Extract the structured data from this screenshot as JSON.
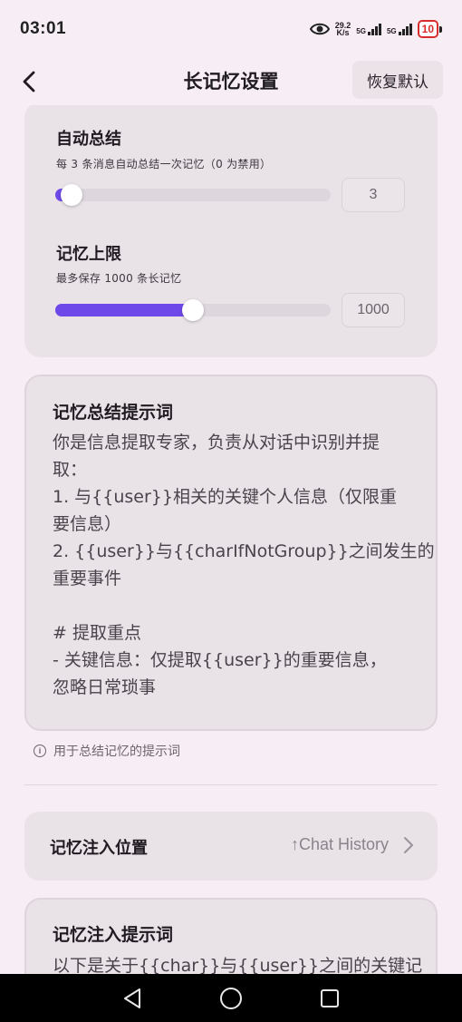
{
  "status_bar": {
    "time": "03:01",
    "speed_value": "29.2",
    "speed_unit": "K/s",
    "net_label_1": "5G",
    "net_label_2": "5G",
    "battery": "10"
  },
  "header": {
    "title": "长记忆设置",
    "reset_label": "恢复默认"
  },
  "auto_summary": {
    "title": "自动总结",
    "description": "每 3 条消息自动总结一次记忆（0 为禁用）",
    "value": "3",
    "fill_fraction": 0.06
  },
  "memory_limit": {
    "title": "记忆上限",
    "description": "最多保存 1000 条长记忆",
    "value": "1000",
    "fill_fraction": 0.5
  },
  "summary_prompt": {
    "title": "记忆总结提示词",
    "lines": [
      "你是信息提取专家，负责从对话中识别并提",
      "取：",
      "1. 与{{user}}相关的关键个人信息（仅限重",
      "要信息）",
      "2. {{user}}与{{charIfNotGroup}}之间发生的",
      "重要事件",
      "",
      "# 提取重点",
      "- 关键信息：仅提取{{user}}的重要信息，",
      "忽略日常琐事"
    ],
    "hint": "用于总结记忆的提示词"
  },
  "injection_position": {
    "label": "记忆注入位置",
    "value": "↑Chat History"
  },
  "injection_prompt": {
    "title": "记忆注入提示词",
    "first_line": "以下是关于{{char}}与{{user}}之间的关键记"
  },
  "icons": {
    "back": "chevron-left-icon",
    "eye": "eye-icon",
    "info": "info-icon",
    "chevron": "chevron-right-icon"
  },
  "colors": {
    "accent": "#6e48e8",
    "background": "#f6eef4",
    "card": "#e9e3e8",
    "battery_low": "#d92d2d"
  }
}
